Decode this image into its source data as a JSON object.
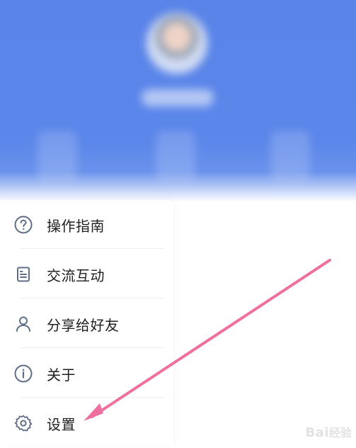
{
  "menu": {
    "items": [
      {
        "label": "操作指南",
        "icon": "help-circle-icon"
      },
      {
        "label": "交流互动",
        "icon": "document-icon"
      },
      {
        "label": "分享给好友",
        "icon": "user-icon"
      },
      {
        "label": "关于",
        "icon": "info-icon"
      },
      {
        "label": "设置",
        "icon": "gear-icon"
      }
    ]
  },
  "colors": {
    "header_blue": "#5b86ea",
    "icon_stroke": "#5f6f88",
    "arrow_pink": "#ef6f9e"
  },
  "watermark": {
    "brand": "Bai",
    "suffix": "经验"
  }
}
